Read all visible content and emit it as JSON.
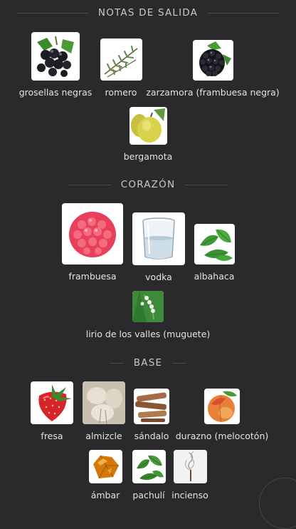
{
  "sections": {
    "top": {
      "title": "NOTAS DE SALIDA"
    },
    "heart": {
      "title": "CORAZÓN"
    },
    "base": {
      "title": "BASE"
    }
  },
  "notes": {
    "grosellas": "grosellas negras",
    "romero": "romero",
    "zarzamora": "zarzamora (frambuesa negra)",
    "bergamota": "bergamota",
    "frambuesa": "frambuesa",
    "vodka": "vodka",
    "albahaca": "albahaca",
    "lirio": "lirio de los valles (muguete)",
    "fresa": "fresa",
    "almizcle": "almizcle",
    "sandalo": "sándalo",
    "durazno": "durazno (melocotón)",
    "ambar": "ámbar",
    "pachuli": "pachulí",
    "incienso": "incienso"
  }
}
